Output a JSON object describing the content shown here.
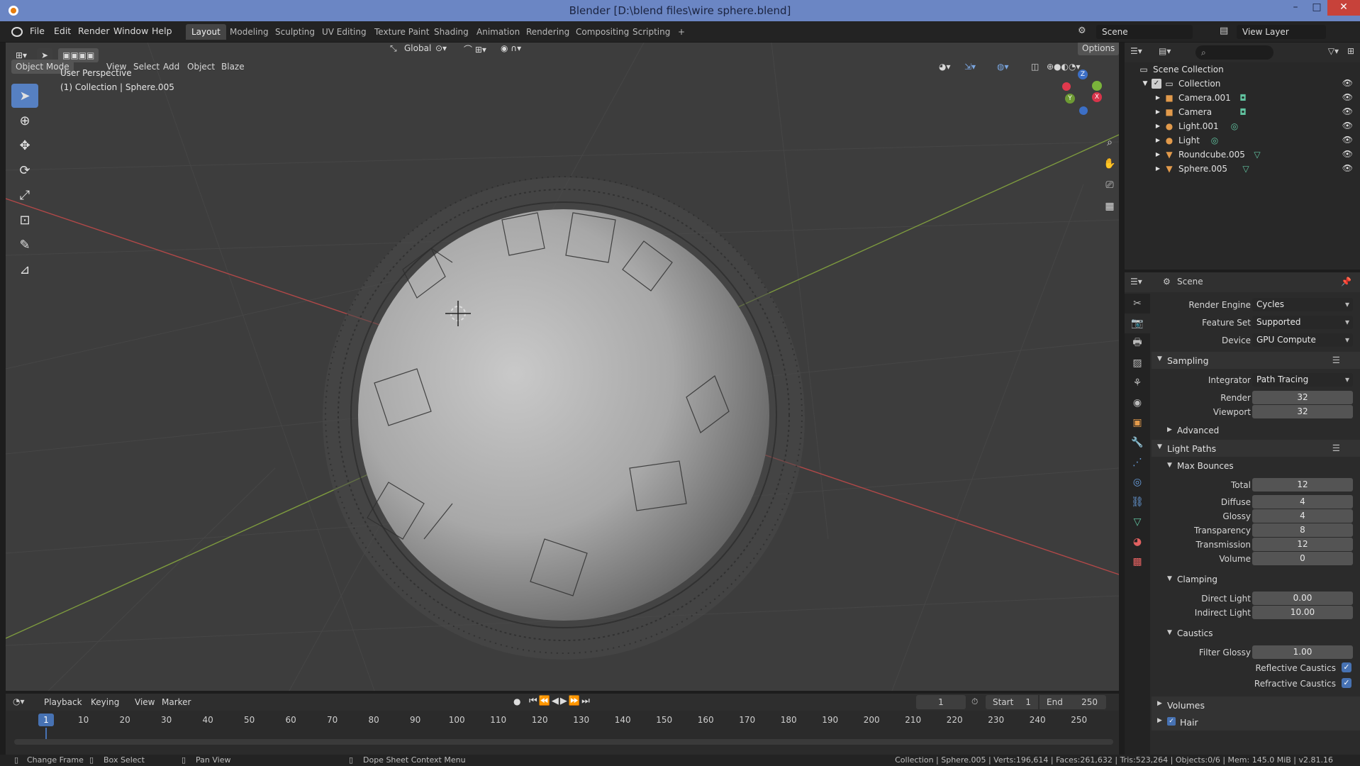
{
  "window": {
    "title": "Blender [D:\\blend files\\wire sphere.blend]",
    "controls": [
      "–",
      "□",
      "✕"
    ]
  },
  "menubar": {
    "items": [
      "File",
      "Edit",
      "Render",
      "Window",
      "Help"
    ]
  },
  "workspaces": {
    "tabs": [
      "Layout",
      "Modeling",
      "Sculpting",
      "UV Editing",
      "Texture Paint",
      "Shading",
      "Animation",
      "Rendering",
      "Compositing",
      "Scripting"
    ],
    "add": "+",
    "active": "Layout"
  },
  "topright": {
    "scene": "Scene",
    "view_layer": "View Layer"
  },
  "viewport": {
    "mode": "Object Mode",
    "menus": [
      "View",
      "Select",
      "Add",
      "Object",
      "Blaze"
    ],
    "transform_orientation": "Global",
    "options": "Options",
    "perspective": "User Perspective",
    "collection_info": "(1) Collection | Sphere.005",
    "gizmo": {
      "z": "Z",
      "y": "Y",
      "x": "X"
    }
  },
  "outliner": {
    "search_placeholder": "",
    "root": "Scene Collection",
    "collection": "Collection",
    "items": [
      {
        "name": "Camera.001",
        "type": "camera"
      },
      {
        "name": "Camera",
        "type": "camera"
      },
      {
        "name": "Light.001",
        "type": "light"
      },
      {
        "name": "Light",
        "type": "light"
      },
      {
        "name": "Roundcube.005",
        "type": "mesh"
      },
      {
        "name": "Sphere.005",
        "type": "mesh"
      }
    ]
  },
  "properties": {
    "context": "Scene",
    "render_engine_label": "Render Engine",
    "render_engine": "Cycles",
    "feature_set_label": "Feature Set",
    "feature_set": "Supported",
    "device_label": "Device",
    "device": "GPU Compute",
    "sampling": "Sampling",
    "integrator_label": "Integrator",
    "integrator": "Path Tracing",
    "render_label": "Render",
    "render_samples": "32",
    "viewport_label": "Viewport",
    "viewport_samples": "32",
    "advanced": "Advanced",
    "light_paths": "Light Paths",
    "max_bounces": "Max Bounces",
    "bounces": [
      {
        "label": "Total",
        "value": "12"
      },
      {
        "label": "Diffuse",
        "value": "4"
      },
      {
        "label": "Glossy",
        "value": "4"
      },
      {
        "label": "Transparency",
        "value": "8"
      },
      {
        "label": "Transmission",
        "value": "12"
      },
      {
        "label": "Volume",
        "value": "0"
      }
    ],
    "clamping": "Clamping",
    "direct_light_label": "Direct Light",
    "direct_light": "0.00",
    "indirect_light_label": "Indirect Light",
    "indirect_light": "10.00",
    "caustics": "Caustics",
    "filter_glossy_label": "Filter Glossy",
    "filter_glossy": "1.00",
    "reflective_caustics": "Reflective Caustics",
    "refractive_caustics": "Refractive Caustics",
    "volumes": "Volumes",
    "hair": "Hair"
  },
  "timeline": {
    "menus": [
      "Playback",
      "Keying",
      "View",
      "Marker"
    ],
    "current_frame": "1",
    "start_label": "Start",
    "start": "1",
    "end_label": "End",
    "end": "250",
    "ticks": [
      "10",
      "20",
      "30",
      "40",
      "50",
      "60",
      "70",
      "80",
      "90",
      "100",
      "110",
      "120",
      "130",
      "140",
      "150",
      "160",
      "170",
      "180",
      "190",
      "200",
      "210",
      "220",
      "230",
      "240",
      "250"
    ],
    "cursor_label": "1"
  },
  "statusbar": {
    "change_frame": "Change Frame",
    "box_select": "Box Select",
    "pan_view": "Pan View",
    "context_menu": "Dope Sheet Context Menu",
    "stats": "Collection | Sphere.005 | Verts:196,614 | Faces:261,632 | Tris:523,264 | Objects:0/6 | Mem: 145.0 MiB | v2.81.16"
  },
  "colors": {
    "accent": "#4772b3",
    "title_bar": "#6b86c4",
    "x_axis": "#c04a4a",
    "y_axis": "#88a844"
  }
}
